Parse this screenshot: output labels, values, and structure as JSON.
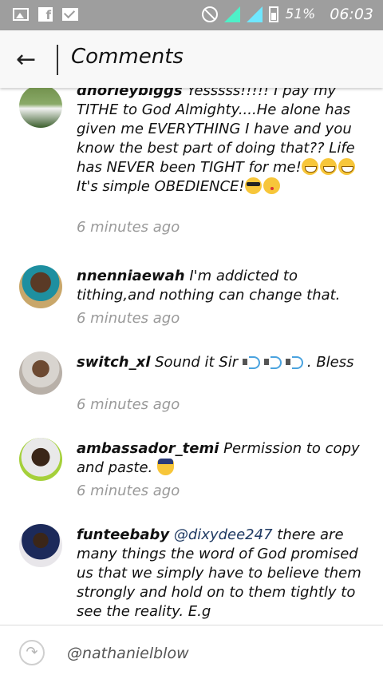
{
  "status_bar": {
    "battery": "51%",
    "time": "06:03",
    "icons": [
      "gallery-icon",
      "facebook-icon",
      "gmail-icon",
      "no-signal-icon",
      "signal-icon",
      "h-network-icon",
      "signal-icon-2",
      "e-network-icon",
      "battery-icon"
    ]
  },
  "header": {
    "title": "Comments",
    "back_icon": "arrow-left-icon"
  },
  "comments": [
    {
      "user": "dhorleybiggs",
      "text": "Yesssss!!!!! I pay my TITHE to God Almighty....He alone has given me EVERYTHING I have and you know the best part of doing that?? Life has NEVER been TIGHT for me!",
      "text_after": " It's simple OBEDIENCE!",
      "time": "6 minutes ago"
    },
    {
      "user": "nnenniaewah",
      "text": "I'm addicted to tithing,and nothing can change that.",
      "time": "6 minutes ago"
    },
    {
      "user": "switch_xl",
      "text": "Sound it Sir",
      "text_after": ". Bless",
      "time": "6 minutes ago"
    },
    {
      "user": "ambassador_temi",
      "text": "Permission to copy and paste.",
      "time": "6 minutes ago"
    },
    {
      "user": "funteebaby",
      "mention": "@dixydee247",
      "text": "there are many things the word of God promised us that we simply have to believe them strongly and hold on to them tightly to see the reality. E.g"
    }
  ],
  "reply": {
    "placeholder": "@nathanielblow",
    "icon": "reply-arrow-icon"
  }
}
